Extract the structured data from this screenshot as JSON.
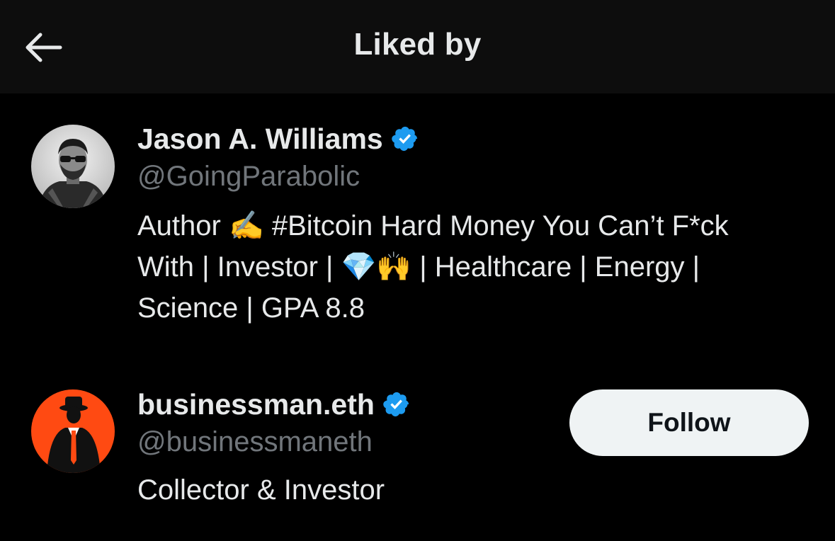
{
  "header": {
    "back_icon": "arrow-left-icon",
    "title": "Liked by"
  },
  "users": [
    {
      "name": "Jason A. Williams",
      "verified": true,
      "handle": "@GoingParabolic",
      "bio": "Author ✍️ #Bitcoin Hard Money You Can’t F*ck\nWith | Investor | 💎🙌 | Healthcare | Energy |\nScience | GPA 8.8",
      "follow_label": ""
    },
    {
      "name": "businessman.eth",
      "verified": true,
      "handle": "@businessmaneth",
      "bio": "Collector & Investor",
      "follow_label": "Follow"
    }
  ],
  "colors": {
    "background": "#000000",
    "header_bg": "#0d0d0d",
    "primary_text": "#e7e9ea",
    "secondary_text": "#71767b",
    "verified_blue": "#1d9bf0",
    "follow_bg": "#eff3f4",
    "follow_text": "#0f1419",
    "avatar_orange": "#ff4a12"
  }
}
